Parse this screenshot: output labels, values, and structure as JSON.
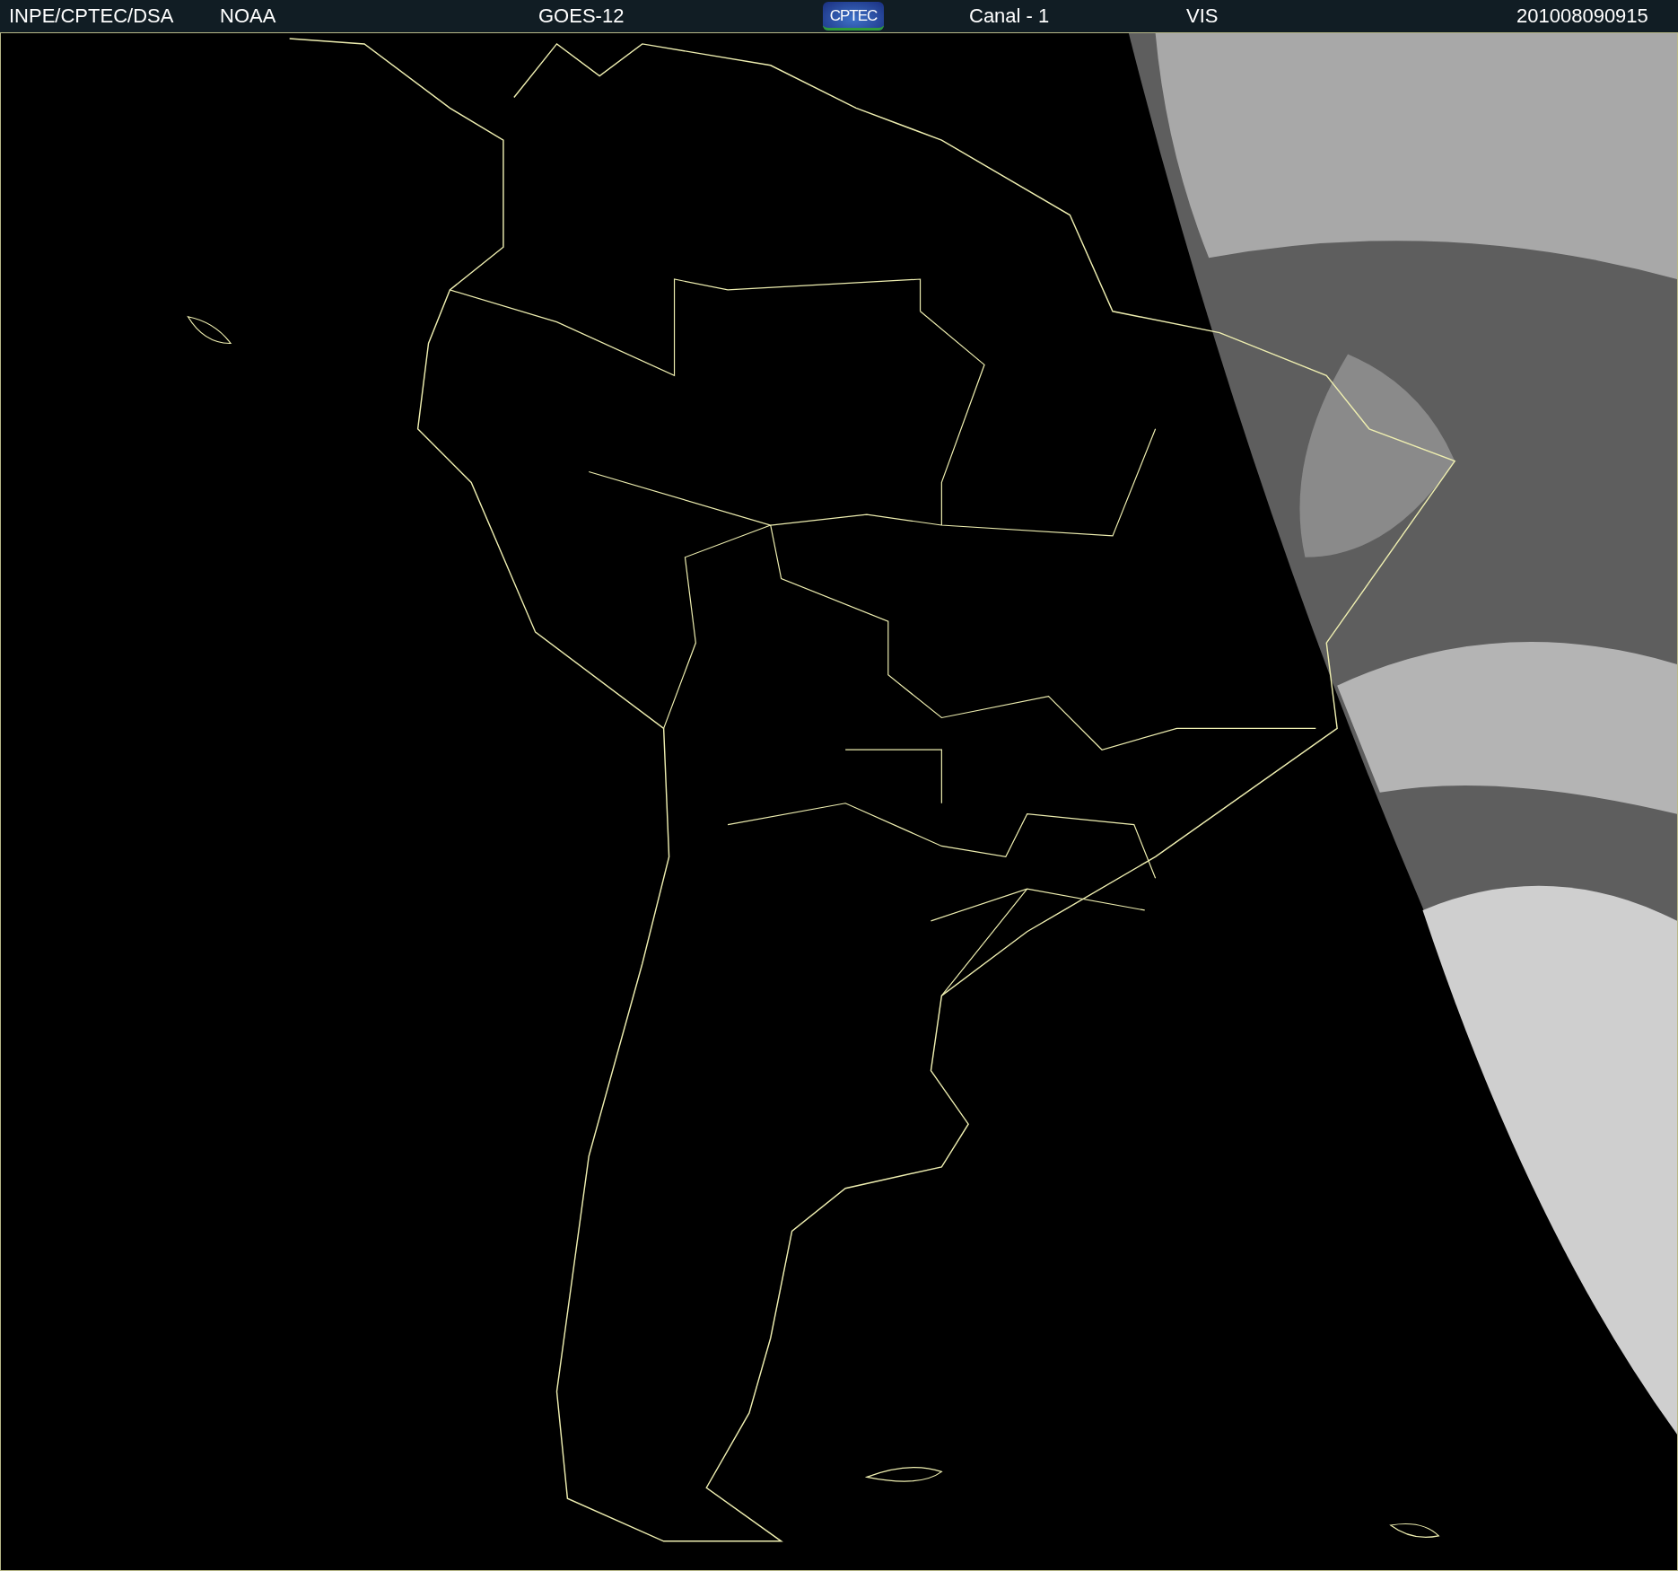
{
  "header": {
    "items": [
      {
        "text": "INPE/CPTEC/DSA"
      },
      {
        "text": "NOAA"
      },
      {
        "text": "GOES-12"
      },
      {
        "text": "CPTEC",
        "kind": "logo"
      },
      {
        "text": "Canal - 1"
      },
      {
        "text": "VIS"
      },
      {
        "text": "201008090915"
      }
    ]
  }
}
